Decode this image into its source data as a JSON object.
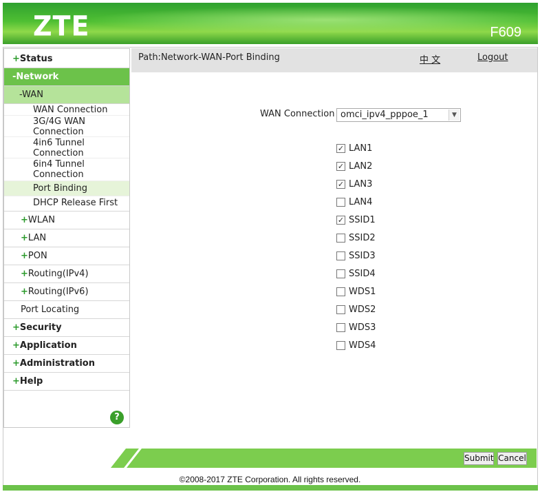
{
  "header": {
    "logo": "ZTE",
    "model": "F609"
  },
  "sidebar": {
    "status": "Status",
    "network": "-Network",
    "wan": "-WAN",
    "wan_items": [
      "WAN Connection",
      "3G/4G WAN Connection",
      "4in6 Tunnel Connection",
      "6in4 Tunnel Connection",
      "Port Binding",
      "DHCP Release First"
    ],
    "wlan": "WLAN",
    "lan": "LAN",
    "pon": "PON",
    "routing_ipv4": "Routing(IPv4)",
    "routing_ipv6": "Routing(IPv6)",
    "port_locating": "Port Locating",
    "security": "Security",
    "application": "Application",
    "administration": "Administration",
    "help": "Help",
    "plus": "+",
    "help_icon": "?"
  },
  "pathbar": {
    "path": "Path:Network-WAN-Port Binding",
    "lang": "中 文",
    "logout": "Logout"
  },
  "form": {
    "wan_label": "WAN Connection",
    "wan_value": "omci_ipv4_pppoe_1",
    "ports": [
      {
        "name": "LAN1",
        "checked": true
      },
      {
        "name": "LAN2",
        "checked": true
      },
      {
        "name": "LAN3",
        "checked": true
      },
      {
        "name": "LAN4",
        "checked": false
      },
      {
        "name": "SSID1",
        "checked": true
      },
      {
        "name": "SSID2",
        "checked": false
      },
      {
        "name": "SSID3",
        "checked": false
      },
      {
        "name": "SSID4",
        "checked": false
      },
      {
        "name": "WDS1",
        "checked": false
      },
      {
        "name": "WDS2",
        "checked": false
      },
      {
        "name": "WDS3",
        "checked": false
      },
      {
        "name": "WDS4",
        "checked": false
      }
    ]
  },
  "footer": {
    "submit": "Submit",
    "cancel": "Cancel",
    "copyright": "©2008-2017 ZTE Corporation. All rights reserved."
  },
  "colors": {
    "brand_green": "#6cc24a",
    "menu_active": "#6cc24a",
    "submenu_active": "#b5e39a"
  }
}
